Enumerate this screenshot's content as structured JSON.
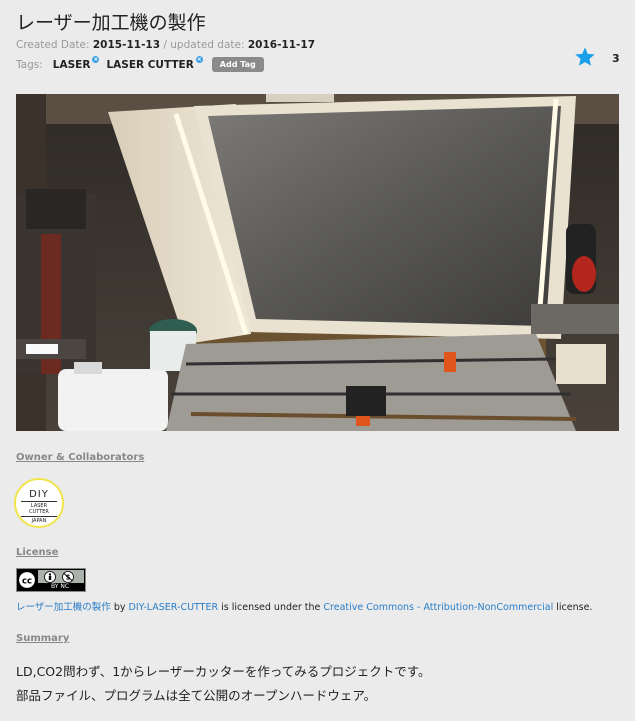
{
  "page": {
    "title": "レーザー加工機の製作"
  },
  "meta": {
    "created_label": "Created Date:",
    "created_value": "2015-11-13",
    "separator": "/",
    "updated_label": "updated date:",
    "updated_value": "2016-11-17"
  },
  "tags": {
    "label": "Tags:",
    "items": [
      "LASER",
      "LASER CUTTER"
    ],
    "add_label": "Add Tag"
  },
  "star": {
    "count": "3",
    "icon": "star-icon",
    "color": "#1aa0e8"
  },
  "sections": {
    "owner": "Owner & Collaborators",
    "license": "License",
    "summary": "Summary"
  },
  "owner": {
    "logo_line1": "DIY",
    "logo_line2": "LASER CUTTER",
    "logo_line3": "JAPAN"
  },
  "license": {
    "badge_text": "BY NC",
    "project": "レーザー加工機の製作",
    "by": "by",
    "author": "DIY-LASER-CUTTER",
    "licensed": "is licensed under the",
    "license_name": "Creative Commons - Attribution-NonCommercial",
    "end": "license."
  },
  "summary": {
    "line1": "LD,CO2問わず、1からレーザーカッターを作ってみるプロジェクトです。",
    "line2": "部品ファイル、プログラムは全て公開のオープンハードウェア。"
  }
}
